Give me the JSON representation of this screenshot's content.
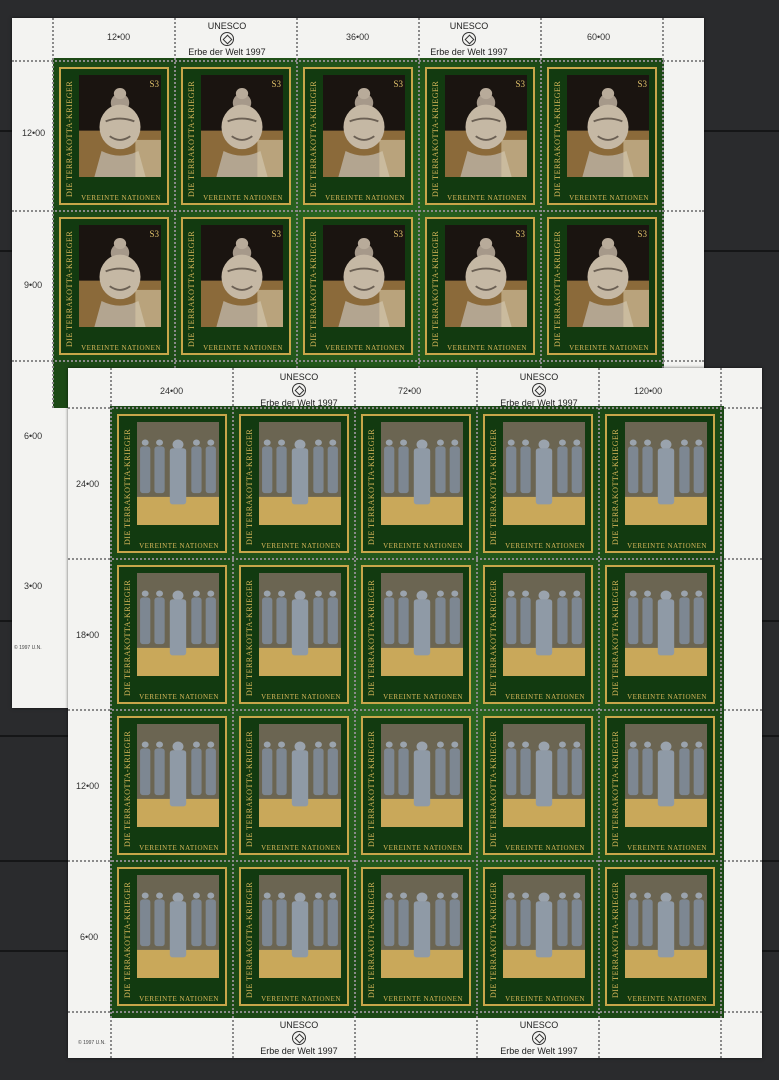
{
  "sheet_top": {
    "stamp_side_text": "DIE TERRAKOTTA-KRIEGER",
    "stamp_bottom_text": "VEREINTE NATIONEN",
    "stamp_value": "S3",
    "top_margin": [
      "12•00",
      "UNESCO",
      "Erbe der Welt 1997",
      "36•00",
      "UNESCO",
      "Erbe der Welt 1997",
      "60•00"
    ],
    "left_margin": [
      "12•00",
      "9•00",
      "6•00",
      "3•00"
    ],
    "copyright": "© 1997 U.N."
  },
  "sheet_bottom": {
    "stamp_side_text": "DIE TERRAKOTTA-KRIEGER",
    "stamp_bottom_text": "VEREINTE NATIONEN",
    "top_margin": [
      "24•00",
      "UNESCO",
      "Erbe der Welt 1997",
      "72•00",
      "UNESCO",
      "Erbe der Welt 1997",
      "120•00"
    ],
    "left_margin": [
      "24•00",
      "18•00",
      "12•00",
      "6•00"
    ],
    "bottom_margin": [
      "UNESCO",
      "Erbe der Welt 1997",
      "UNESCO",
      "Erbe der Welt 1997"
    ],
    "copyright": "© 1997 U.N."
  },
  "colors": {
    "stamp_green": "#1f4e18",
    "gold_frame": "#c8a64a",
    "sheet_paper": "#f3f3f1",
    "background": "#2a2b2d"
  }
}
